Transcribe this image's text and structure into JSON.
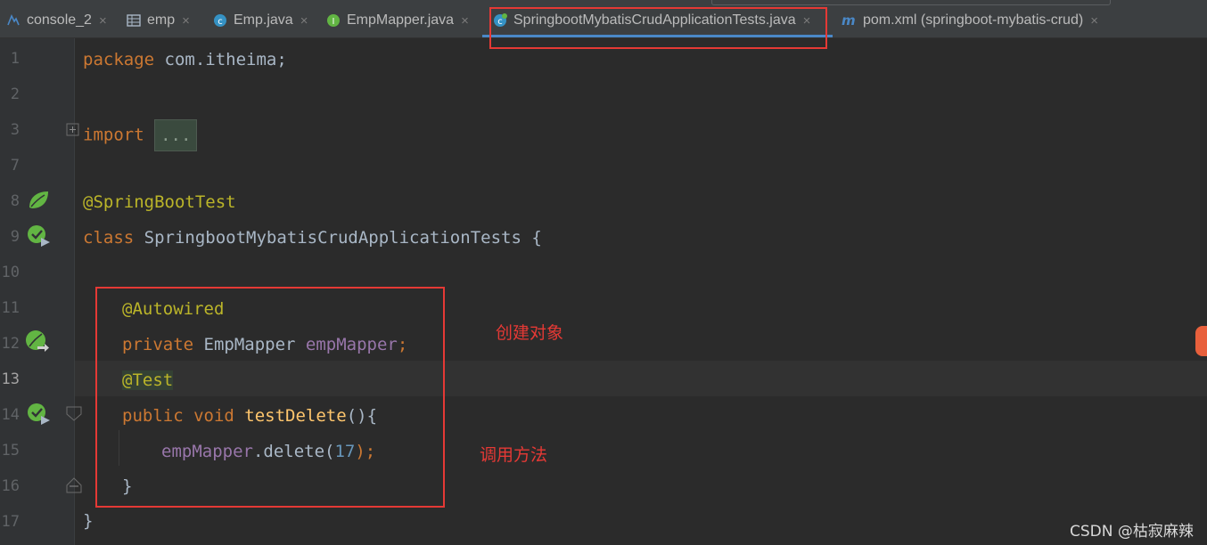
{
  "tabs": [
    {
      "label": "console_2",
      "icon": "console-icon",
      "close": "×"
    },
    {
      "label": "emp",
      "icon": "table-icon",
      "close": "×"
    },
    {
      "label": "Emp.java",
      "icon": "class-icon",
      "close": "×"
    },
    {
      "label": "EmpMapper.java",
      "icon": "interface-icon",
      "close": "×"
    },
    {
      "label": "SpringbootMybatisCrudApplicationTests.java",
      "icon": "spring-test-class-icon",
      "close": "×",
      "active": true
    },
    {
      "label": "pom.xml (springboot-mybatis-crud)",
      "icon": "maven-icon",
      "close": "×"
    }
  ],
  "line_numbers": [
    "1",
    "2",
    "3",
    "7",
    "8",
    "9",
    "10",
    "11",
    "12",
    "13",
    "14",
    "15",
    "16",
    "17"
  ],
  "current_line": "13",
  "code": {
    "l1_kw": "package",
    "l1_rest": " com.itheima;",
    "l3_kw": "import",
    "l3_fold": "...",
    "l8_ann": "@SpringBootTest",
    "l9_kw": "class",
    "l9_rest": " SpringbootMybatisCrudApplicationTests {",
    "l11_ann": "@Autowired",
    "l12_kw": "private",
    "l12_type": " EmpMapper ",
    "l12_field": "empMapper",
    "l12_semi": ";",
    "l13_ann": "@Test",
    "l14_kw": "public void",
    "l14_sp": " ",
    "l14_method": "testDelete",
    "l14_rest": "(){",
    "l15_field": "empMapper",
    "l15_call": ".delete(",
    "l15_num": "17",
    "l15_end": ");",
    "l16": "}",
    "l17": "}"
  },
  "annotations": {
    "create_object": "创建对象",
    "call_method": "调用方法"
  },
  "watermark": "CSDN @枯寂麻辣",
  "colors": {
    "keyword": "#cc7832",
    "annotation": "#bbb529",
    "field": "#9876aa",
    "method": "#ffc66d",
    "number": "#6897bb",
    "highlight_red": "#e53935"
  }
}
